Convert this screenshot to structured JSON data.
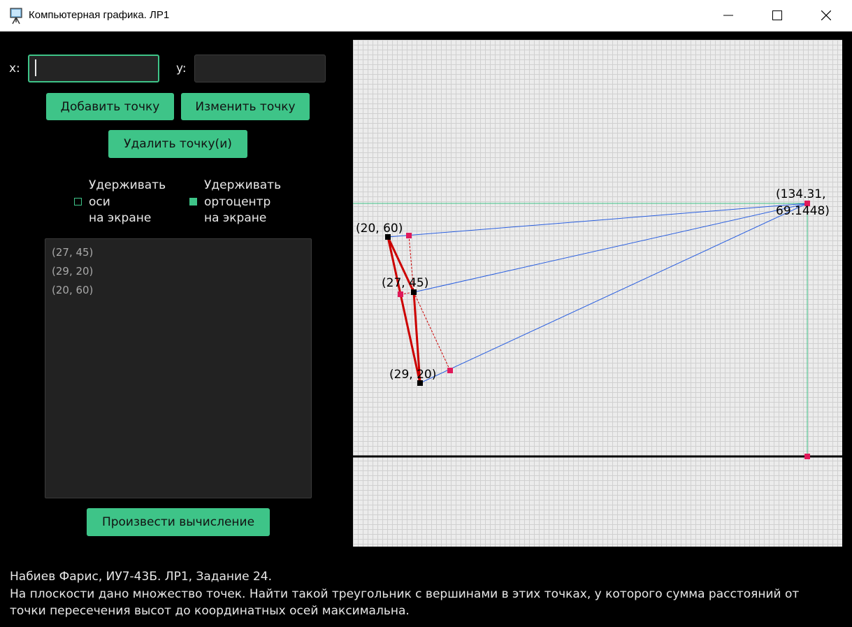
{
  "window": {
    "title": "Компьютерная графика. ЛР1",
    "buttons": [
      "minimize-icon",
      "maximize-icon",
      "close-icon"
    ]
  },
  "inputs": {
    "x_label": "x:",
    "x_value": "",
    "y_label": "y:",
    "y_value": ""
  },
  "buttons": {
    "add": "Добавить точку",
    "edit": "Изменить точку",
    "delete": "Удалить точку(и)",
    "compute": "Произвести вычисление"
  },
  "checkboxes": [
    {
      "lines": [
        "Удерживать",
        "оси",
        "на экране"
      ],
      "checked": false
    },
    {
      "lines": [
        "Удерживать",
        "ортоцентр",
        "на экране"
      ],
      "checked": true
    }
  ],
  "points_list": [
    "(27, 45)",
    "(29, 20)",
    "(20, 60)"
  ],
  "plot": {
    "vertex_labels": [
      "(20, 60)",
      "(27, 45)",
      "(29, 20)"
    ],
    "orthocenter_label": [
      "(134.31,",
      "69.1448)"
    ],
    "colors": {
      "triangle": "#cc0000",
      "altitude": "#2a5fe0",
      "orthocenter_guides": "#3ec488",
      "axis": "#000000",
      "foot_marker": "#e0195a",
      "vertex_marker": "#000000"
    }
  },
  "footer": {
    "line1": "Набиев Фарис, ИУ7-43Б. ЛР1, Задание 24.",
    "line2": "На плоскости дано множество точек. Найти такой треугольник с вершинами в этих точках, у которого сумма расстояний от",
    "line3": "точки пересечения высот до координатных осей максимальна."
  },
  "colors": {
    "accent": "#3ec488",
    "background": "#000000",
    "input_bg": "#242424"
  }
}
